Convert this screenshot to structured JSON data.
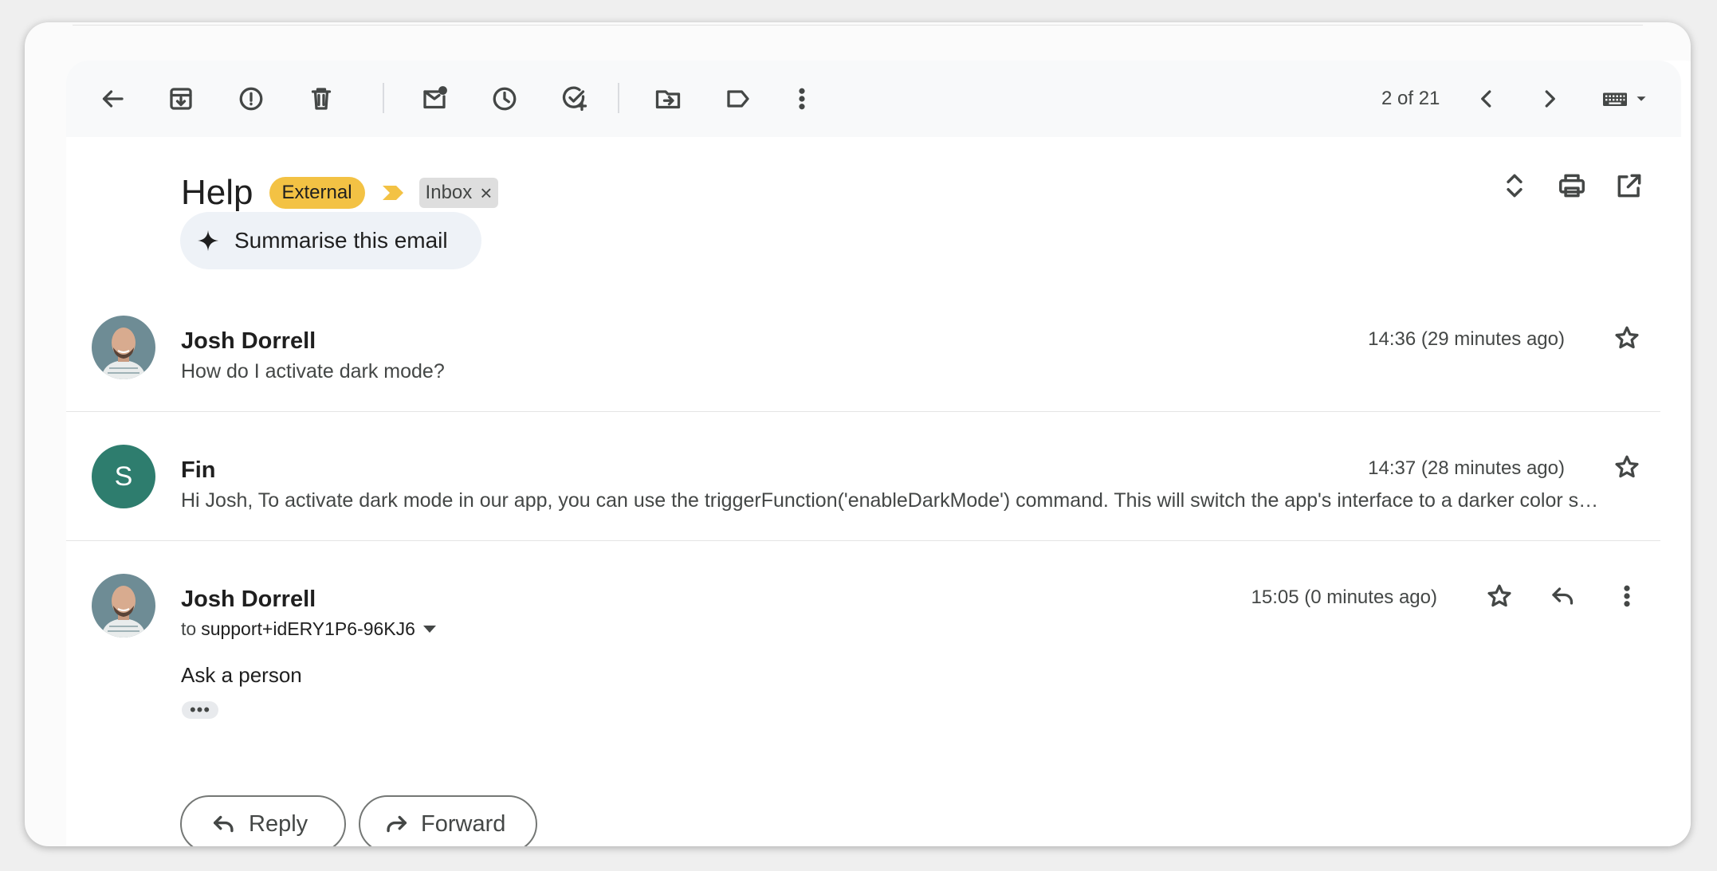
{
  "toolbar": {
    "pagination": "2 of 21",
    "icons": [
      "back-arrow-icon",
      "archive-icon",
      "report-spam-icon",
      "delete-icon",
      "mark-unread-icon",
      "snooze-icon",
      "add-to-tasks-icon",
      "move-to-icon",
      "label-icon",
      "more-vert-icon",
      "chevron-left-icon",
      "chevron-right-icon",
      "keyboard-icon"
    ]
  },
  "thread": {
    "subject": "Help",
    "labels": {
      "external": "External",
      "inbox": "Inbox",
      "remove": "×"
    },
    "summarise_label": "Summarise this email"
  },
  "messages": [
    {
      "sender": "Josh Dorrell",
      "time": "14:36 (29 minutes ago)",
      "snippet": "How do I activate dark mode?"
    },
    {
      "sender": "Fin",
      "avatar_letter": "S",
      "time": "14:37 (28 minutes ago)",
      "snippet": "Hi Josh, To activate dark mode in our app, you can use the triggerFunction('enableDarkMode') command. This will switch the app's interface to a darker color s…"
    },
    {
      "sender": "Josh Dorrell",
      "time": "15:05 (0 minutes ago)",
      "to_prefix": "to",
      "to_address": "support+idERY1P6-96KJ6",
      "body": "Ask a person",
      "trimmed": "•••"
    }
  ],
  "actions": {
    "reply": "Reply",
    "forward": "Forward"
  },
  "colors": {
    "external_chip": "#f3c244",
    "fin_avatar": "#2e7d6e",
    "importance_marker": "#f3c244"
  }
}
